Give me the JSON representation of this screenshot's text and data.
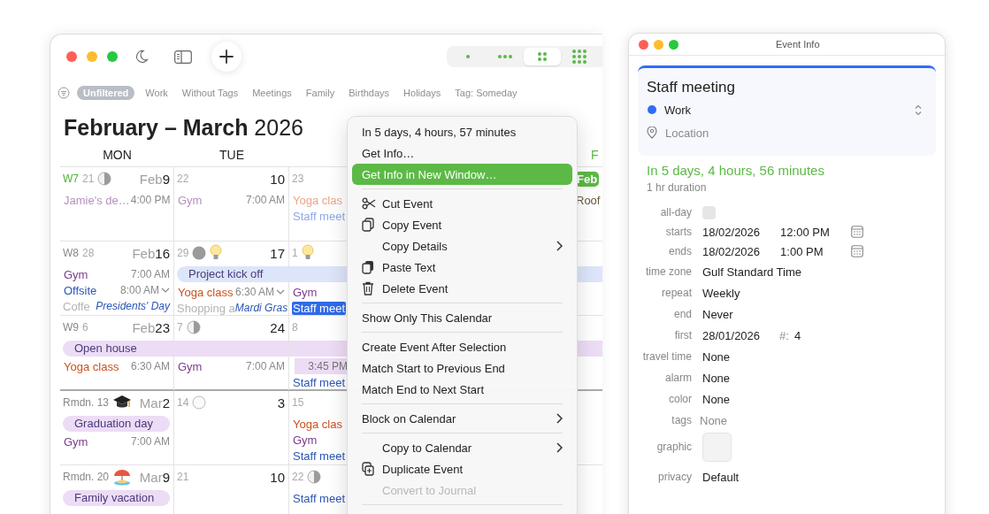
{
  "calendar": {
    "views": [
      {
        "kind": "single",
        "selected": false
      },
      {
        "kind": "row",
        "selected": false
      },
      {
        "kind": "grid",
        "selected": true
      },
      {
        "kind": "month",
        "selected": false
      }
    ],
    "filters": [
      {
        "label": "Unfiltered",
        "selected": true
      },
      {
        "label": "Work",
        "selected": false
      },
      {
        "label": "Without Tags",
        "selected": false
      },
      {
        "label": "Meetings",
        "selected": false
      },
      {
        "label": "Family",
        "selected": false
      },
      {
        "label": "Birthdays",
        "selected": false
      },
      {
        "label": "Holidays",
        "selected": false
      },
      {
        "label": "Tag: Someday",
        "selected": false
      }
    ],
    "title": "**February – March** 2026",
    "columns": [
      {
        "label": "MON",
        "today": false
      },
      {
        "label": "TUE",
        "today": false
      },
      {
        "label": "F",
        "today": true
      }
    ],
    "weeks": [
      {
        "boundary": false,
        "cells": [
          {
            "week": "W7",
            "current": true,
            "lunar": "21",
            "moon": {
              "kind": "half"
            },
            "month": "Feb",
            "day": "9",
            "events": [
              {
                "kind": "timed",
                "title": "Jamie's de…",
                "time": "4:00 PM",
                "color": "#b58fbf",
                "selected": false
              }
            ]
          },
          {
            "lunar": "22",
            "day": "10",
            "events": [
              {
                "kind": "timed",
                "title": "Gym",
                "time": "7:00 AM",
                "color": "#b58fbf",
                "selected": false
              }
            ]
          },
          {
            "lunar": "23",
            "events": [
              {
                "kind": "timed",
                "title": "Yoga clas",
                "color": "#eba58a",
                "selected": false
              },
              {
                "kind": "timed",
                "title": "Staff meet",
                "color": "#8fa8e6",
                "selected": false
              }
            ]
          },
          {
            "month": "Feb",
            "today": true,
            "events": [
              {
                "kind": "timed",
                "title": "Roof",
                "color": "#6b5a3a",
                "selected": false
              }
            ]
          }
        ]
      },
      {
        "boundary": false,
        "cells": [
          {
            "week": "W8",
            "current": false,
            "lunar": "28",
            "month": "Feb",
            "day": "16",
            "events": [
              {
                "kind": "timed",
                "title": "Gym",
                "time": "7:00 AM",
                "color": "#7a3d8c",
                "selected": false
              },
              {
                "kind": "timed",
                "title": "Offsite",
                "time": "8:00 AM",
                "color": "#2c56b3",
                "selected": false,
                "more": true
              },
              {
                "kind": "holiday",
                "title": "Presidents' Day",
                "behind": "Coffe"
              }
            ]
          },
          {
            "lunar": "29",
            "moon": {
              "kind": "new"
            },
            "badge": {
              "kind": "bulb"
            },
            "day": "17",
            "events": [
              {
                "kind": "bar",
                "title": "Project kick off",
                "color": "#dde5fa",
                "extends": true
              },
              {
                "kind": "timed",
                "title": "Yoga class",
                "time": "6:30 AM",
                "color": "#c9521f",
                "selected": false,
                "more": true
              },
              {
                "kind": "holiday",
                "title": "Mardi Gras",
                "behind": "Shopping a"
              }
            ]
          },
          {
            "lunar": "1",
            "badge": {
              "kind": "bulb"
            },
            "events": [
              {
                "kind": "timed",
                "title": "Gym",
                "color": "#7a3d8c",
                "selected": false
              },
              {
                "kind": "timed",
                "title": "Staff meet",
                "color": "#2f6be8",
                "selected": true
              }
            ]
          }
        ]
      },
      {
        "boundary": false,
        "cells": [
          {
            "week": "W9",
            "current": false,
            "lunar": "6",
            "month": "Feb",
            "day": "23",
            "events": [
              {
                "kind": "bar",
                "title": "Open house",
                "color": "#eddcf5",
                "extends": true
              },
              {
                "kind": "timed",
                "title": "Yoga class",
                "time": "6:30 AM",
                "color": "#c9521f",
                "selected": false
              }
            ]
          },
          {
            "lunar": "7",
            "moon": {
              "kind": "half"
            },
            "day": "24",
            "events": [
              {
                "kind": "timed",
                "title": "Gym",
                "time": "7:00 AM",
                "color": "#7a3d8c",
                "selected": false
              }
            ]
          },
          {
            "lunar": "8",
            "events": [
              {
                "kind": "timebox",
                "time": "3:45 PM",
                "color": "#eddcf5"
              },
              {
                "kind": "timed",
                "title": "Staff meet",
                "color": "#2c56b3",
                "selected": false
              }
            ]
          }
        ]
      },
      {
        "boundary": true,
        "cells": [
          {
            "week": "Rmdn. 13",
            "current": false,
            "badge": {
              "kind": "cap"
            },
            "month": "Mar",
            "day": "2",
            "events": [
              {
                "kind": "bar",
                "title": "Graduation day",
                "color": "#eddcf5",
                "extends": false
              },
              {
                "kind": "timed",
                "title": "Gym",
                "time": "7:00 AM",
                "color": "#7a3d8c",
                "selected": false
              }
            ]
          },
          {
            "lunar": "14",
            "moon": {
              "kind": "full"
            },
            "day": "3"
          },
          {
            "lunar": "15",
            "events": [
              {
                "kind": "timed",
                "title": "Yoga clas",
                "color": "#c9521f",
                "selected": false
              },
              {
                "kind": "timed",
                "title": "Gym",
                "color": "#7a3d8c",
                "selected": false
              },
              {
                "kind": "timed",
                "title": "Staff meet",
                "color": "#2c56b3",
                "selected": false
              }
            ]
          }
        ]
      },
      {
        "boundary": false,
        "cells": [
          {
            "week": "Rmdn. 20",
            "current": false,
            "badge": {
              "kind": "beach"
            },
            "month": "Mar",
            "day": "9",
            "events": [
              {
                "kind": "bar",
                "title": "Family vacation",
                "color": "#eddcf5",
                "extends": false
              }
            ]
          },
          {
            "lunar": "21",
            "day": "10"
          },
          {
            "lunar": "22",
            "moon": {
              "kind": "half"
            },
            "events": [
              {
                "kind": "timed",
                "title": "Staff meet",
                "color": "#2c56b3",
                "selected": false
              }
            ]
          }
        ]
      }
    ],
    "menu": [
      {
        "with_icons": false,
        "items": [
          {
            "label": "In 5 days, 4 hours, 57 minutes",
            "selected": false,
            "disabled": false
          },
          {
            "label": "Get Info…",
            "selected": false,
            "disabled": false
          },
          {
            "label": "Get Info in New Window…",
            "selected": true,
            "disabled": false
          }
        ]
      },
      {
        "with_icons": true,
        "items": [
          {
            "label": "Cut Event",
            "kind": "scissors",
            "selected": false,
            "disabled": false
          },
          {
            "label": "Copy Event",
            "kind": "copy",
            "selected": false,
            "disabled": false
          },
          {
            "label": "Copy Details",
            "submenu": true,
            "selected": false,
            "disabled": false
          },
          {
            "label": "Paste Text",
            "kind": "paste",
            "selected": false,
            "disabled": false
          },
          {
            "label": "Delete Event",
            "kind": "trash",
            "selected": false,
            "disabled": false
          }
        ]
      },
      {
        "with_icons": false,
        "items": [
          {
            "label": "Show Only This Calendar",
            "selected": false,
            "disabled": false
          }
        ]
      },
      {
        "with_icons": false,
        "items": [
          {
            "label": "Create Event After Selection",
            "selected": false,
            "disabled": false
          },
          {
            "label": "Match Start to Previous End",
            "selected": false,
            "disabled": false
          },
          {
            "label": "Match End to Next Start",
            "selected": false,
            "disabled": false
          }
        ]
      },
      {
        "with_icons": false,
        "items": [
          {
            "label": "Block on Calendar",
            "submenu": true,
            "selected": false,
            "disabled": false
          }
        ]
      },
      {
        "with_icons": true,
        "items": [
          {
            "label": "Copy to Calendar",
            "submenu": true,
            "selected": false,
            "disabled": false
          },
          {
            "label": "Duplicate Event",
            "kind": "duplicate",
            "selected": false,
            "disabled": false
          },
          {
            "label": "Convert to Journal",
            "selected": false,
            "disabled": true
          }
        ]
      }
    ]
  },
  "event_info": {
    "title": "Event Info",
    "event_title": "Staff meeting",
    "calendar": {
      "name": "Work",
      "color": "#2f6df6"
    },
    "location": {
      "placeholder": "Location"
    },
    "countdown": "In 5 days, 4 hours, 56 minutes",
    "duration": "1 hr duration",
    "fields": [
      {
        "kind": "checkbox",
        "label": "all-day",
        "checked": false
      },
      {
        "kind": "datetime",
        "label": "starts",
        "date": "18/02/2026",
        "time": "12:00 PM"
      },
      {
        "kind": "datetime",
        "label": "ends",
        "date": "18/02/2026",
        "time": "1:00 PM"
      },
      {
        "kind": "text",
        "label": "time zone",
        "value": "Gulf Standard Time"
      },
      {
        "kind": "text",
        "label": "repeat",
        "value": "Weekly"
      },
      {
        "kind": "text",
        "label": "end",
        "value": "Never"
      },
      {
        "kind": "first",
        "label": "first",
        "value": "28/01/2026",
        "count_label": "#:",
        "count": "4"
      },
      {
        "kind": "text",
        "label": "travel time",
        "value": "None"
      },
      {
        "kind": "text",
        "label": "alarm",
        "value": "None"
      },
      {
        "kind": "text",
        "label": "color",
        "value": "None"
      },
      {
        "kind": "placeholder",
        "label": "tags",
        "placeholder": "None"
      },
      {
        "kind": "graphic",
        "label": "graphic"
      },
      {
        "kind": "text",
        "label": "privacy",
        "value": "Default"
      }
    ]
  }
}
